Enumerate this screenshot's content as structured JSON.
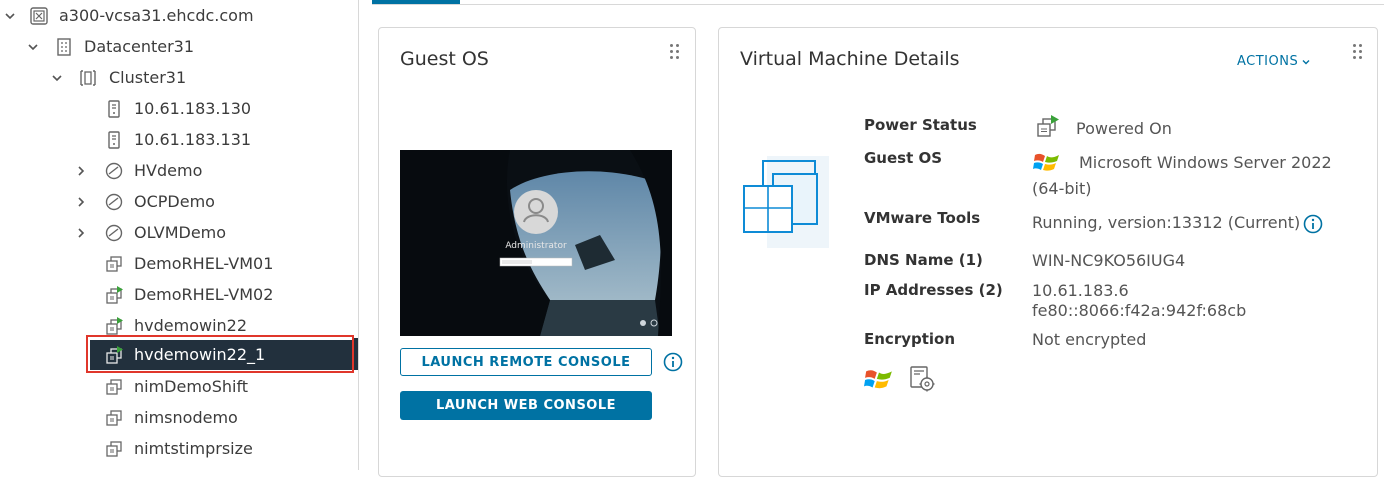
{
  "tree": {
    "vcenter": "a300-vcsa31.ehcdc.com",
    "datacenter": "Datacenter31",
    "cluster": "Cluster31",
    "hosts": [
      "10.61.183.130",
      "10.61.183.131"
    ],
    "pools": [
      "HVdemo",
      "OCPDemo",
      "OLVMDemo"
    ],
    "vms": [
      "DemoRHEL-VM01",
      "DemoRHEL-VM02",
      "hvdemowin22",
      "hvdemowin22_1",
      "nimDemoShift",
      "nimsnodemo",
      "nimtstimprsize"
    ],
    "selected": "hvdemowin22_1"
  },
  "guest_os_card": {
    "title": "Guest OS",
    "console_user": "Administrator",
    "launch_remote_label": "LAUNCH REMOTE CONSOLE",
    "launch_web_label": "LAUNCH WEB CONSOLE"
  },
  "vm_card": {
    "title": "Virtual Machine Details",
    "actions_label": "ACTIONS",
    "power_status_label": "Power Status",
    "power_status_value": "Powered On",
    "guest_os_label": "Guest OS",
    "guest_os_value": "Microsoft Windows Server 2022",
    "guest_os_value_2": "(64-bit)",
    "vmware_tools_label": "VMware Tools",
    "vmware_tools_value": "Running, version:13312 (Current)",
    "dns_label": "DNS Name (1)",
    "dns_value": "WIN-NC9KO56IUG4",
    "ip_label": "IP Addresses (2)",
    "ip_values": [
      "10.61.183.6",
      "fe80::8066:f42a:942f:68cb"
    ],
    "encryption_label": "Encryption",
    "encryption_value": "Not encrypted"
  },
  "colors": {
    "accent": "#0072a3",
    "selected_bg": "#22303d",
    "highlight_border": "#e0362b",
    "power_green": "#3aa13a"
  },
  "icons": {
    "vcenter": "vcenter-icon",
    "datacenter": "datacenter-icon",
    "cluster": "cluster-icon",
    "host": "host-icon",
    "pool": "resource-pool-icon",
    "vm": "vm-icon",
    "vm_on": "vm-powered-on-icon"
  }
}
